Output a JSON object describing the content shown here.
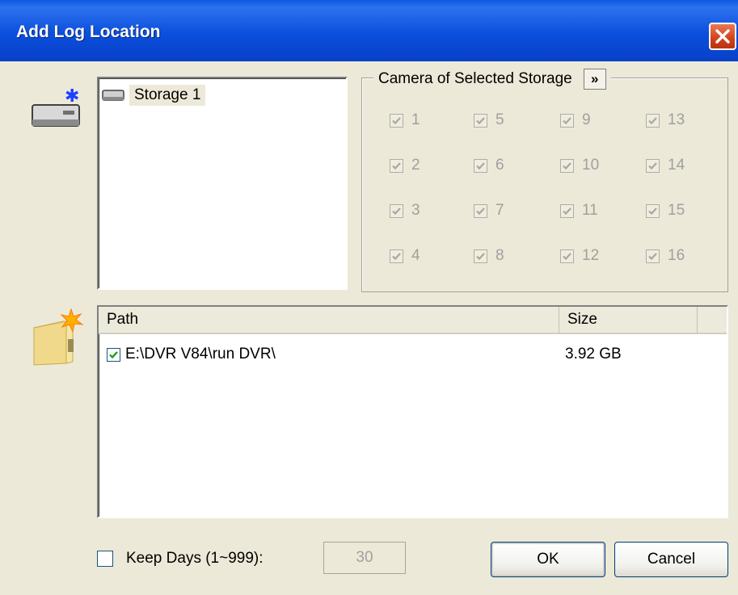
{
  "window": {
    "title": "Add Log Location"
  },
  "storage": {
    "items": [
      {
        "label": "Storage 1"
      }
    ]
  },
  "camera_group": {
    "label": "Camera of Selected Storage",
    "expand_label": "»",
    "cameras": [
      "1",
      "2",
      "3",
      "4",
      "5",
      "6",
      "7",
      "8",
      "9",
      "10",
      "11",
      "12",
      "13",
      "14",
      "15",
      "16"
    ]
  },
  "paths": {
    "columns": {
      "path": "Path",
      "size": "Size"
    },
    "rows": [
      {
        "path": "E:\\DVR V84\\run DVR\\",
        "size": "3.92 GB",
        "checked": true
      }
    ]
  },
  "keep_days": {
    "label": "Keep Days (1~999):",
    "value": "30",
    "checked": false
  },
  "buttons": {
    "ok": "OK",
    "cancel": "Cancel"
  }
}
